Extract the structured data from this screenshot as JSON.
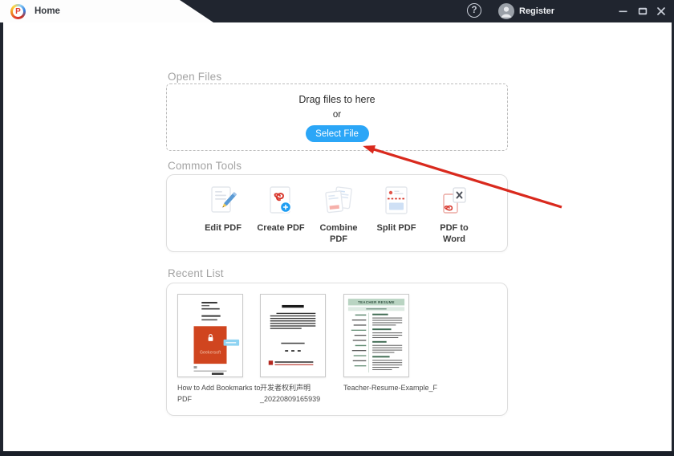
{
  "window": {
    "title_tab": "Home",
    "logo_letter": "P",
    "help_glyph": "?",
    "register_label": "Register"
  },
  "open_files": {
    "title": "Open Files",
    "drag_text": "Drag files to here",
    "or_text": "or",
    "select_button_label": "Select File"
  },
  "common_tools": {
    "title": "Common Tools",
    "tools": [
      {
        "label": "Edit PDF",
        "icon": "edit-pdf-icon"
      },
      {
        "label": "Create PDF",
        "icon": "create-pdf-icon"
      },
      {
        "label": "Combine PDF",
        "icon": "combine-pdf-icon"
      },
      {
        "label": "Split PDF",
        "icon": "split-pdf-icon"
      },
      {
        "label": "PDF to Word",
        "icon": "pdf-to-word-icon"
      }
    ]
  },
  "recent_list": {
    "title": "Recent List",
    "items": [
      {
        "name": "How to Add Bookmarks to\nPDF",
        "thumb_brand": "Geekersoft"
      },
      {
        "name": "开发者权利声明\n_20220809165939"
      },
      {
        "name": "Teacher-Resume-Example_F",
        "thumb_title": "TEACHER RESUME"
      }
    ]
  },
  "annotation": {
    "arrow_color": "#d9291d"
  },
  "colors": {
    "titlebar_bg": "#20252f",
    "accent_blue": "#2ba6f7",
    "section_title_gray": "#a3a3a3"
  }
}
